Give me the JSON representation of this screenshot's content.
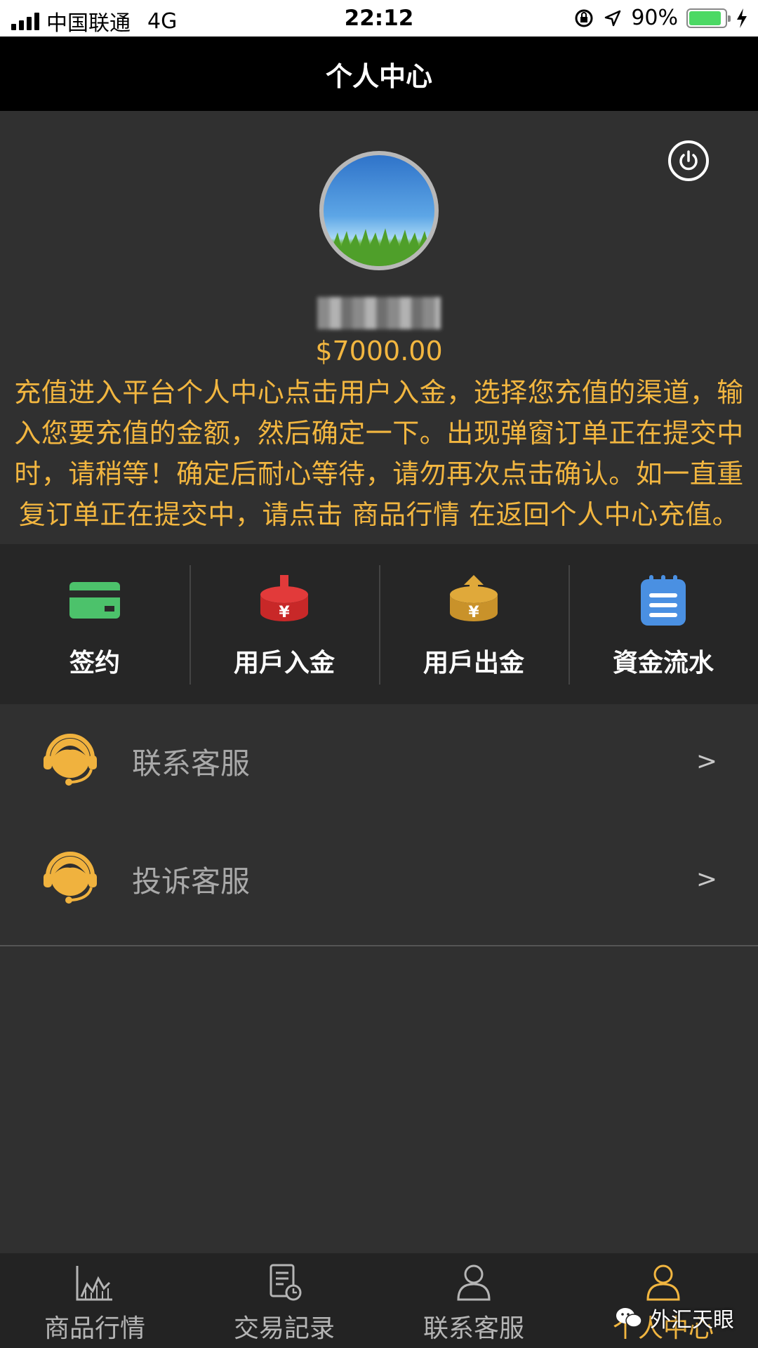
{
  "status_bar": {
    "carrier": "中国联通",
    "network": "4G",
    "time": "22:12",
    "battery": "90%"
  },
  "header": {
    "title": "个人中心"
  },
  "profile": {
    "balance": "$7000.00"
  },
  "notice": "充值进入平台个人中心点击用户入金，选择您充值的渠道，输入您要充值的金额，然后确定一下。出现弹窗订单正在提交中时，请稍等！确定后耐心等待，请勿再次点击确认。如一直重复订单正在提交中，请点击 商品行情 在返回个人中心充值。",
  "actions": [
    {
      "label": "签约",
      "icon": "card-icon"
    },
    {
      "label": "用戶入金",
      "icon": "deposit-icon"
    },
    {
      "label": "用戶出金",
      "icon": "withdraw-icon"
    },
    {
      "label": "資金流水",
      "icon": "notepad-icon"
    }
  ],
  "menu": [
    {
      "label": "联系客服",
      "arrow": ">"
    },
    {
      "label": "投诉客服",
      "arrow": ">"
    }
  ],
  "tabs": [
    {
      "label": "商品行情",
      "icon": "chart-icon"
    },
    {
      "label": "交易記录",
      "icon": "document-icon"
    },
    {
      "label": "联系客服",
      "icon": "person-icon"
    },
    {
      "label": "个人中心",
      "icon": "person-icon"
    }
  ],
  "watermark": "外汇天眼",
  "colors": {
    "accent": "#f2b640",
    "background": "#303030",
    "header": "#000000"
  }
}
